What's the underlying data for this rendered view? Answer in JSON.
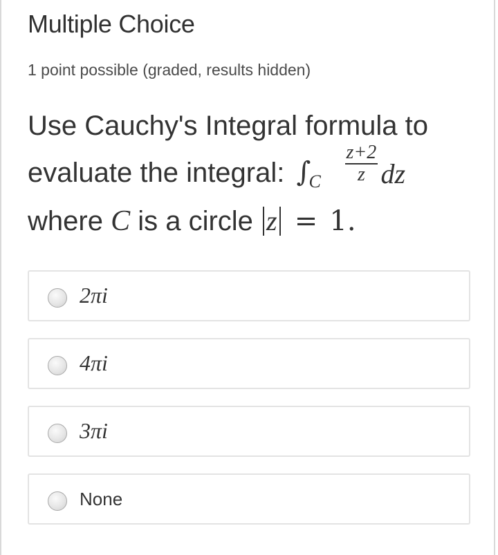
{
  "problem": {
    "title": "Multiple Choice",
    "subtitle": "1 point possible (graded, results hidden)"
  },
  "question": {
    "line1": "Use Cauchy's Integral formula to",
    "line2_prefix": "evaluate the integral:",
    "integral_symbol": "∫",
    "integral_subscript": "C",
    "fraction_numerator": "z+2",
    "fraction_denominator": "z",
    "differential": "dz",
    "line3_prefix": "where",
    "contour_var": "C",
    "line3_mid": "is a circle",
    "abs_var": "z",
    "equals": "=",
    "radius": "1."
  },
  "options": [
    {
      "label": "2πi",
      "selected": false
    },
    {
      "label": "4πi",
      "selected": false
    },
    {
      "label": "3πi",
      "selected": false
    },
    {
      "label": "None",
      "selected": false
    }
  ]
}
